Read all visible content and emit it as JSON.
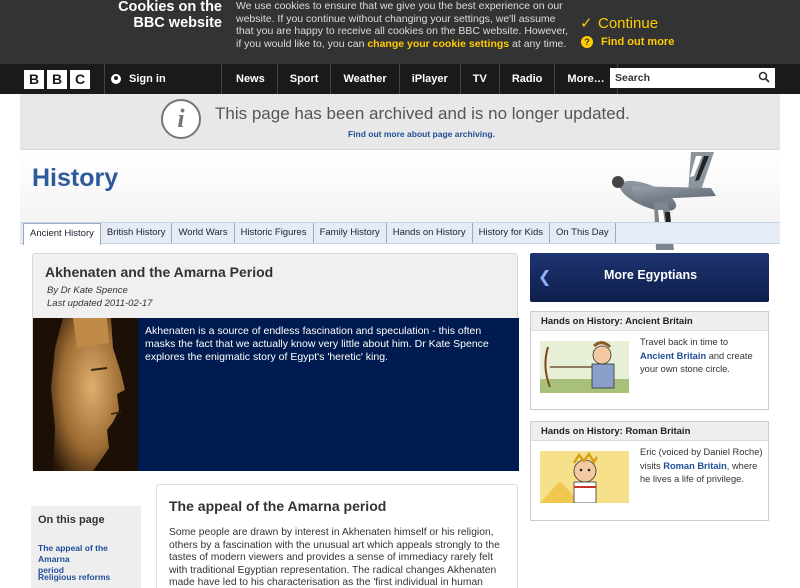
{
  "cookie": {
    "title_line1": "Cookies on the",
    "title_line2": "BBC website",
    "text_before": "We use cookies to ensure that we give you the best experience on our website. If you continue without changing your settings, we'll assume that you are happy to receive all cookies on the BBC website. However, if you would like to, you can ",
    "text_link": "change your cookie settings",
    "text_after": " at any time.",
    "continue_label": "Continue",
    "more_label": "Find out more"
  },
  "nav": {
    "logo_letters": [
      "B",
      "B",
      "C"
    ],
    "signin_label": "Sign in",
    "links": [
      "News",
      "Sport",
      "Weather",
      "iPlayer",
      "TV",
      "Radio",
      "More…"
    ],
    "search_placeholder": "Search"
  },
  "archive": {
    "icon_glyph": "i",
    "message": "This page has been archived and is no longer updated.",
    "link": "Find out more about page archiving."
  },
  "banner": {
    "title": "History"
  },
  "tabs": [
    "Ancient History",
    "British History",
    "World Wars",
    "Historic Figures",
    "Family History",
    "Hands on History",
    "History for Kids",
    "On This Day"
  ],
  "article": {
    "title": "Akhenaten and the Amarna Period",
    "author": "By Dr Kate Spence",
    "updated": "Last updated 2011-02-17",
    "summary": "Akhenaten is a source of endless fascination and speculation - this often masks the fact that we actually know very little about him. Dr Kate Spence explores the enigmatic story of Egypt's 'heretic' king."
  },
  "section": {
    "title": "The appeal of the Amarna period",
    "text": "Some people are drawn by interest in Akhenaten himself or his religion, others by a fascination with the unusual art which appeals strongly to the tastes of modern viewers and provides a sense of immediacy rarely felt with traditional Egyptian representation. The radical changes Akhenaten made have led to his characterisation as the 'first individual in human"
  },
  "onpage": {
    "title": "On this page",
    "link1_line1": "The appeal of the Amarna",
    "link1_line2": "period",
    "link2": "Religious reforms"
  },
  "sidebar": {
    "more_label": "More Egyptians",
    "card1": {
      "title": "Hands on History: Ancient Britain",
      "text_before": "Travel back in time to ",
      "text_link": "Ancient Britain",
      "text_after": " and create your own stone circle."
    },
    "card2": {
      "title": "Hands on History: Roman Britain",
      "text_before": "Eric (voiced by Daniel Roche) visits ",
      "text_link": "Roman Britain",
      "text_after": ", where he lives a life of privilege."
    }
  },
  "colors": {
    "brand_blue": "#2e5a9c",
    "link_blue": "#1f4e99",
    "cookie_accent": "#ffcc00",
    "panel_navy": "#001b4f"
  }
}
